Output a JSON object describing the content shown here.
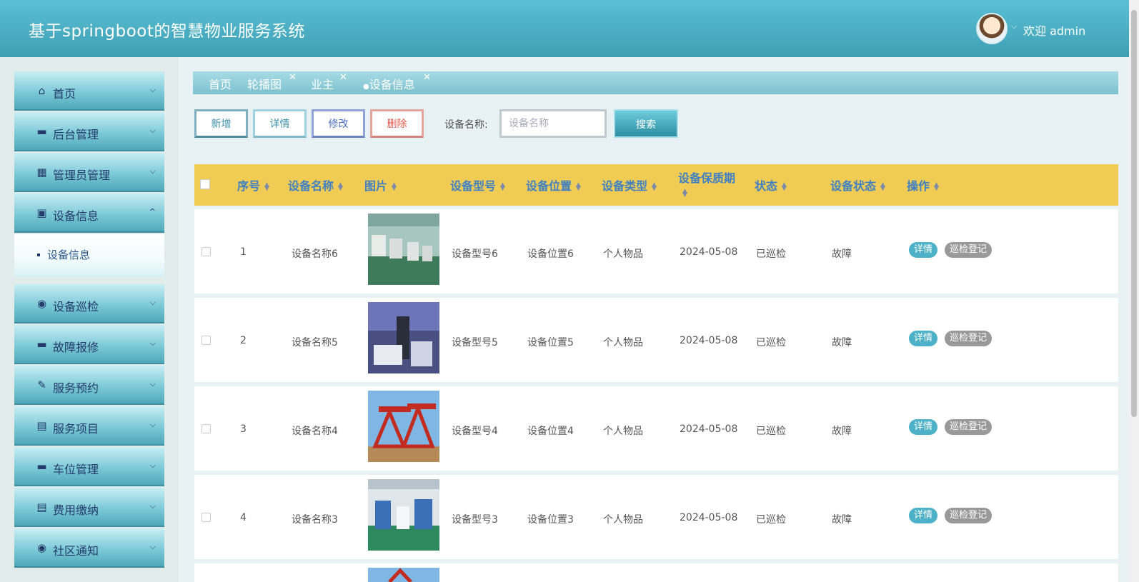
{
  "header": {
    "title": "基于springboot的智慧物业服务系统",
    "welcome": "欢迎 admin"
  },
  "sidebar": {
    "items": [
      {
        "label": "首页",
        "icon": "home-icon"
      },
      {
        "label": "后台管理",
        "icon": "archive-icon"
      },
      {
        "label": "管理员管理",
        "icon": "grid-icon"
      },
      {
        "label": "设备信息",
        "icon": "briefcase-icon",
        "expanded": true
      },
      {
        "label": "设备巡检",
        "icon": "circle-play-icon"
      },
      {
        "label": "故障报修",
        "icon": "card-icon"
      },
      {
        "label": "服务预约",
        "icon": "pen-icon"
      },
      {
        "label": "服务项目",
        "icon": "layout-icon"
      },
      {
        "label": "车位管理",
        "icon": "ticket-icon"
      },
      {
        "label": "费用缴纳",
        "icon": "server-icon"
      },
      {
        "label": "社区通知",
        "icon": "dot-circle-icon"
      }
    ],
    "submenu": {
      "label": "设备信息"
    }
  },
  "tabs": [
    {
      "label": "首页",
      "closable": false
    },
    {
      "label": "轮播图",
      "closable": true
    },
    {
      "label": "业主",
      "closable": true
    },
    {
      "label": "设备信息",
      "closable": true,
      "active": true
    }
  ],
  "toolbar": {
    "add": "新增",
    "detail": "详情",
    "edit": "修改",
    "delete": "删除",
    "search_label": "设备名称:",
    "search_placeholder": "设备名称",
    "search_button": "搜索"
  },
  "table": {
    "header_color": "#f0cc55",
    "columns": [
      "序号",
      "设备名称",
      "图片",
      "设备型号",
      "设备位置",
      "设备类型",
      "设备保质期",
      "状态",
      "设备状态",
      "操作"
    ],
    "rows": [
      {
        "index": "1",
        "name": "设备名称6",
        "model": "设备型号6",
        "location": "设备位置6",
        "type": "个人物品",
        "warranty": "2024-05-08",
        "status": "已巡检",
        "device_status": "故障",
        "image": "factory-line"
      },
      {
        "index": "2",
        "name": "设备名称5",
        "model": "设备型号5",
        "location": "设备位置5",
        "type": "个人物品",
        "warranty": "2024-05-08",
        "status": "已巡检",
        "device_status": "故障",
        "image": "lab-machine"
      },
      {
        "index": "3",
        "name": "设备名称4",
        "model": "设备型号4",
        "location": "设备位置4",
        "type": "个人物品",
        "warranty": "2024-05-08",
        "status": "已巡检",
        "device_status": "故障",
        "image": "pump-jacks"
      },
      {
        "index": "4",
        "name": "设备名称3",
        "model": "设备型号3",
        "location": "设备位置3",
        "type": "个人物品",
        "warranty": "2024-05-08",
        "status": "已巡检",
        "device_status": "故障",
        "image": "workshop"
      }
    ],
    "row_actions": {
      "detail": "详情",
      "inspect": "巡检登记"
    }
  }
}
